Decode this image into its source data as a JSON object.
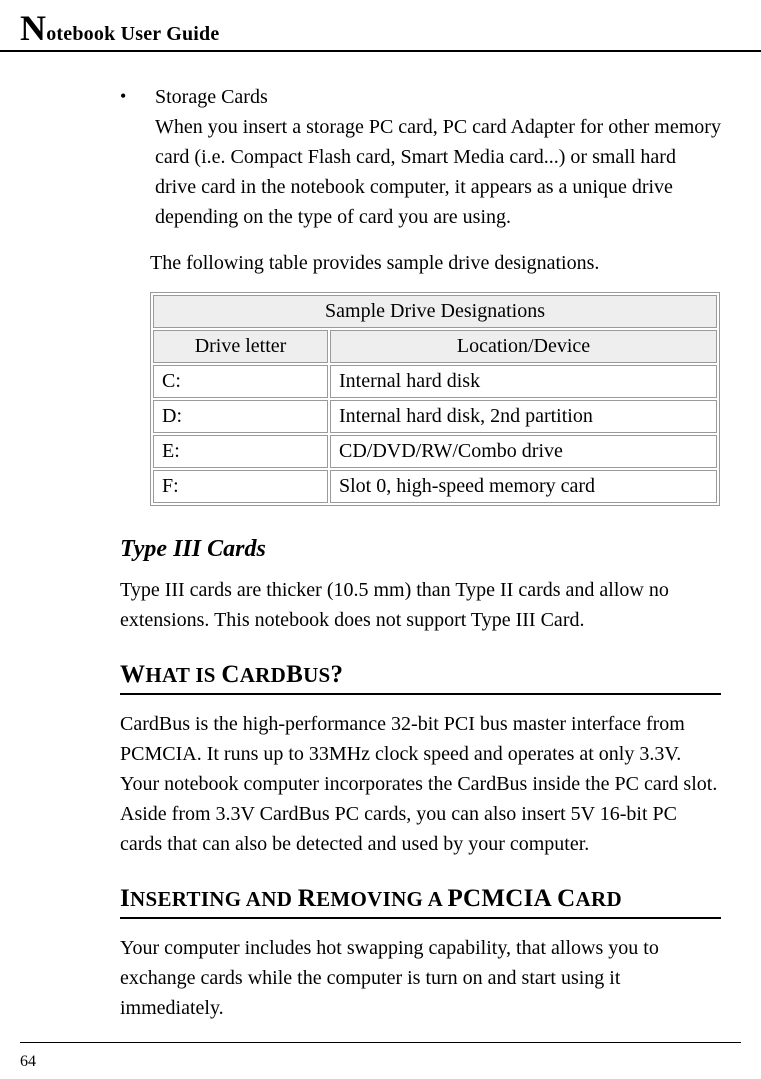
{
  "header": {
    "title_dropcap": "N",
    "title_rest": "otebook User Guide"
  },
  "bullet": {
    "title": "Storage Cards",
    "text": "When you insert a storage PC card, PC card Adapter for other memory card (i.e. Compact Flash card, Smart Media card...) or small hard drive card in the notebook computer, it appears as a unique drive depending on the type of card you are using."
  },
  "following_text": "The following table provides sample drive designations.",
  "table": {
    "caption": "Sample Drive Designations",
    "col1": "Drive letter",
    "col2": "Location/Device",
    "rows": [
      {
        "letter": "C:",
        "desc": "Internal hard disk"
      },
      {
        "letter": "D:",
        "desc": "Internal hard disk, 2nd partition"
      },
      {
        "letter": "E:",
        "desc": "CD/DVD/RW/Combo drive"
      },
      {
        "letter": "F:",
        "desc": "Slot 0, high-speed memory card"
      }
    ]
  },
  "type3": {
    "heading": "Type III Cards",
    "text": "Type III cards are thicker (10.5 mm) than Type II cards and allow no extensions. This notebook does not support Type III Card."
  },
  "cardbus": {
    "h_parts": {
      "w": "W",
      "hat_is": "HAT IS ",
      "c": "C",
      "ard": "ARD",
      "b": "B",
      "us": "US",
      "q": "?"
    },
    "text": "CardBus is the high-performance 32-bit PCI bus master interface from PCMCIA. It runs up to 33MHz clock speed and operates at only 3.3V. Your notebook computer incorporates the CardBus inside the PC card slot. Aside from 3.3V CardBus PC cards, you can also insert 5V 16-bit PC cards that can also be detected and used by your computer."
  },
  "insrem": {
    "h_parts": {
      "i": "I",
      "nserting": "NSERTING AND ",
      "r": "R",
      "emoving": "EMOVING A ",
      "p": "PCMCIA C",
      "ard": "ARD"
    },
    "text": "Your computer includes hot swapping capability, that allows you to exchange cards while the computer is turn on and start using it immediately."
  },
  "page_number": "64"
}
